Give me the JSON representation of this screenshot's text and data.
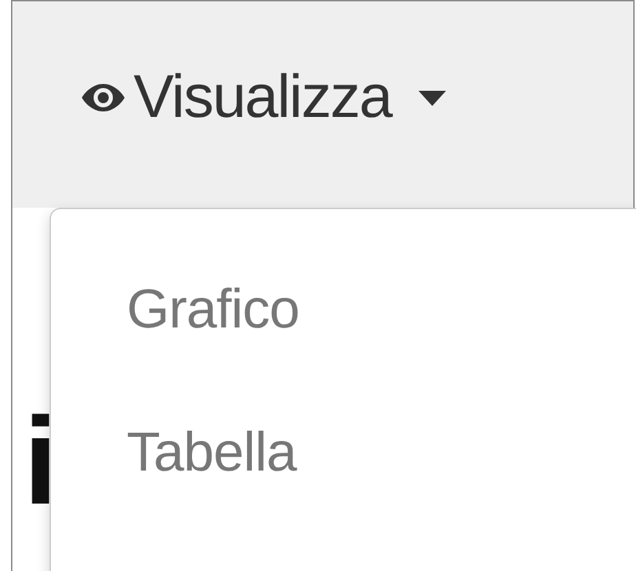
{
  "toolbar": {
    "button": {
      "label": "Visualizza",
      "expanded": true
    }
  },
  "background_text": "i",
  "menu": {
    "items": [
      {
        "label": "Grafico"
      },
      {
        "label": "Tabella"
      }
    ]
  }
}
